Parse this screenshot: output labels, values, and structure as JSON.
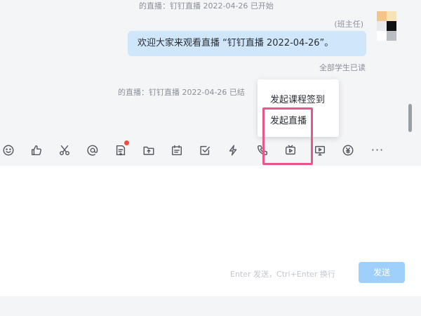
{
  "chat": {
    "system_top": "的直播：钉钉直播 2022-04-26 已开始",
    "sender": "(班主任)",
    "bubble_text": "欢迎大家来观看直播 “钉钉直播 2022-04-26”。",
    "read_status": "全部学生已读",
    "system_mid": "的直播：钉钉直播 2022-04-26 已结"
  },
  "popup": {
    "items": [
      {
        "label": "发起课程签到"
      },
      {
        "label": "发起直播"
      }
    ]
  },
  "toolbar": {
    "icons": [
      "emoji-icon",
      "thumbs-up-icon",
      "scissors-icon",
      "at-icon",
      "doc-card-icon",
      "upload-folder-icon",
      "calendar-icon",
      "checkbox-icon",
      "lightning-icon",
      "phone-icon",
      "live-tv-icon",
      "screen-share-icon",
      "currency-icon",
      "more-icon"
    ],
    "more_label": "···"
  },
  "input": {
    "hint": "Enter 发送，Ctrl+Enter 换行",
    "send_label": "发送"
  },
  "colors": {
    "accent": "#9fd0fb",
    "bubble": "#cfe6fb",
    "highlight": "#e8578b",
    "notification": "#f14c3c"
  }
}
